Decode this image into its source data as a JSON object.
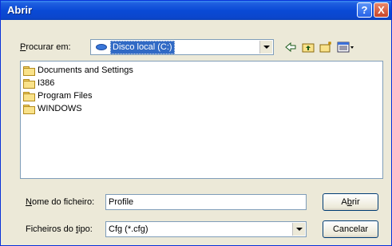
{
  "window": {
    "title": "Abrir",
    "help": "?",
    "close": "X"
  },
  "lookin": {
    "label_pre": "P",
    "label_post": "rocurar em:",
    "value": "Disco local (C:)"
  },
  "toolbar": {
    "back_icon": "arrow-left-icon",
    "up_icon": "folder-up-icon",
    "new_folder_icon": "new-folder-icon",
    "view_icon": "view-menu-icon"
  },
  "files": [
    {
      "name": "Documents and Settings"
    },
    {
      "name": "I386"
    },
    {
      "name": "Program Files"
    },
    {
      "name": "WINDOWS"
    }
  ],
  "filename": {
    "label_pre": "N",
    "label_post": "ome do ficheiro:",
    "value": "Profile"
  },
  "filetype": {
    "label_pre": "Ficheiros do ",
    "label_u": "t",
    "label_post": "ipo:",
    "value": "Cfg (*.cfg)"
  },
  "buttons": {
    "open_pre": "A",
    "open_u": "b",
    "open_post": "rir",
    "cancel": "Cancelar"
  }
}
